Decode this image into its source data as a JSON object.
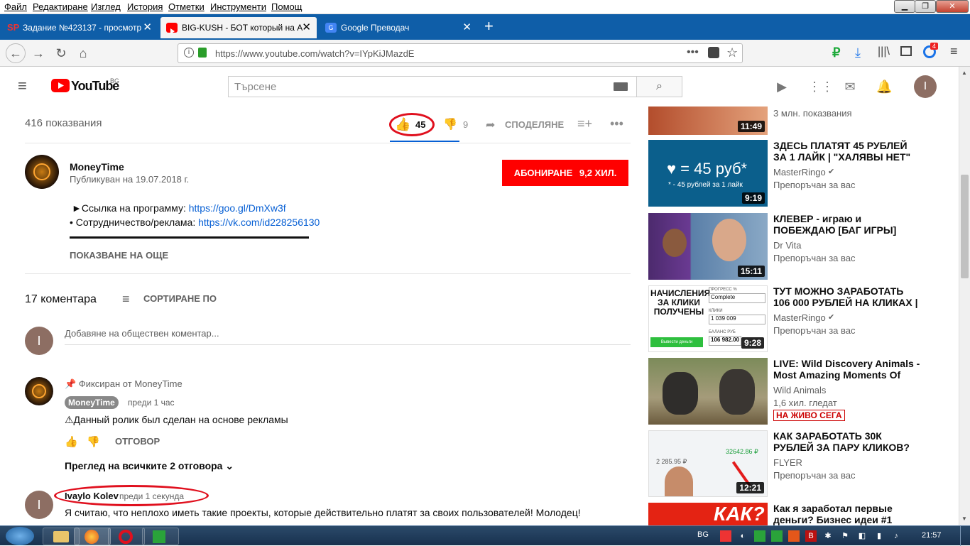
{
  "menubar": {
    "items": [
      "Файл",
      "Редактиране",
      "Изглед",
      "История",
      "Отметки",
      "Инструменти",
      "Помощ"
    ]
  },
  "tabs": [
    {
      "title": "Задание №423137 - просмотр",
      "favicon": "SP"
    },
    {
      "title": "BIG-KUSH - БОТ который на А",
      "favicon": "youtube"
    },
    {
      "title": "Google Преводач",
      "favicon": "google-translate"
    }
  ],
  "new_tab_label": "+",
  "navbar": {
    "url": "https://www.youtube.com/watch?v=IYpKiJMazdE",
    "badge_count": "4"
  },
  "header": {
    "logo_text": "YouTube",
    "logo_region": "BG",
    "search_placeholder": "Търсене",
    "avatar_letter": "I"
  },
  "video": {
    "views": "416 показвания",
    "likes": "45",
    "dislikes": "9",
    "share_label": "СПОДЕЛЯНЕ"
  },
  "channel": {
    "name": "MoneyTime",
    "published": "Публикуван на 19.07.2018 г.",
    "subscribe_label": "АБОНИРАНЕ",
    "subscriber_count": "9,2 ХИЛ."
  },
  "description": {
    "line1_text": "►Ссылка на программу: ",
    "line1_link": "https://goo.gl/DmXw3f",
    "line2_text": "• Сотрудничество/реклама: ",
    "line2_link": "https://vk.com/id228256130",
    "show_more": "ПОКАЗВАНЕ НА ОЩЕ"
  },
  "comments": {
    "count_label": "17 коментара",
    "sort_label": "СОРТИРАНЕ ПО",
    "add_placeholder": "Добавяне на обществен коментар...",
    "user_avatar_letter": "I",
    "pinned": {
      "pinned_label": "Фиксиран от MoneyTime",
      "author": "MoneyTime",
      "time": "преди 1 час",
      "text": "⚠Данный ролик был сделан на основе рекламы",
      "reply_label": "ОТГОВОР",
      "view_replies": "Преглед на всичките 2 отговора"
    },
    "latest": {
      "author": "Ivaylo Kolev",
      "time": "преди 1 секунда",
      "avatar_letter": "I",
      "text": "Я считаю, что неплохо иметь такие проекты, которые действительно платят за своих пользователей! Молодец!"
    }
  },
  "sidebar": {
    "top_partial": {
      "views": "3 млн. показвания",
      "duration": "11:49"
    },
    "items": [
      {
        "title": "ЗДЕСЬ ПЛАТЯТ 45 РУБЛЕЙ ЗА 1 ЛАЙК | \"ХАЛЯВЫ НЕТ\"",
        "channel": "MasterRingo",
        "meta": "Препоръчан за вас",
        "duration": "9:19",
        "thumb_text": "♥ = 45 руб*",
        "thumb_sub": "* - 45 рублей за 1 лайк",
        "verified": true
      },
      {
        "title": "КЛЕВЕР - играю и ПОБЕЖДАЮ [БАГ ИГРЫ]",
        "channel": "Dr Vita",
        "meta": "Препоръчан за вас",
        "duration": "15:11",
        "verified": false
      },
      {
        "title": "ТУТ МОЖНО ЗАРАБОТАТЬ 106 000 РУБЛЕЙ НА КЛИКАХ |",
        "channel": "MasterRingo",
        "meta": "Препоръчан за вас",
        "duration": "9:28",
        "verified": true,
        "thumb_text": "НАЧИСЛЕНИЯ ЗА КЛИКИ ПОЛУЧЕНЫ",
        "thumb_progress": "ПРОГРЕСС %",
        "thumb_complete": "Complete",
        "thumb_clicks_label": "КЛИКИ",
        "thumb_clicks": "1 039 009",
        "thumb_balance_label": "БАЛАНС РУБ",
        "thumb_balance": "106 982.00",
        "thumb_btn": "Вывести деньги"
      },
      {
        "title": "LIVE: Wild Discovery Animals - Most Amazing Moments Of",
        "channel": "Wild Animals",
        "meta": "1,6 хил. гледат",
        "live_badge": "НА ЖИВО СЕГА",
        "verified": false
      },
      {
        "title": "КАК ЗАРАБОТАТЬ 30К РУБЛЕЙ ЗА ПАРУ КЛИКОВ?",
        "channel": "FLYER",
        "meta": "Препоръчан за вас",
        "duration": "12:21",
        "thumb_amount1": "2 285.95 ₽",
        "thumb_amount2": "32642.86 ₽",
        "verified": false
      },
      {
        "title": "Как я заработал первые деньги? Бизнес идеи #1",
        "thumb_text": "КАК?"
      }
    ]
  },
  "taskbar": {
    "lang": "BG",
    "time": "21:57"
  },
  "colors": {
    "youtube_red": "#ff0000",
    "subscribe_red": "#ff0000",
    "link_blue": "#065fd4",
    "annotation_red": "#e0101e",
    "tabbar_blue": "#0f5ea8"
  }
}
